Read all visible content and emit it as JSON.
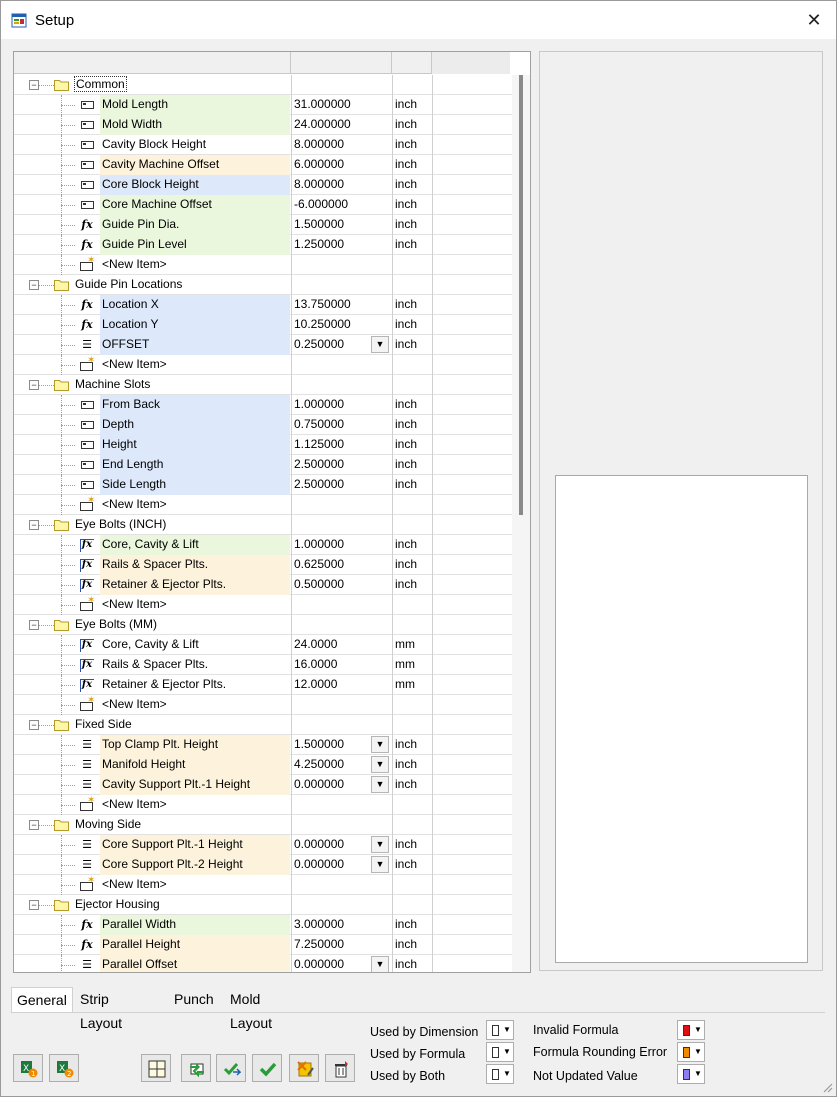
{
  "window": {
    "title": "Setup",
    "close_glyph": "✕"
  },
  "groups": [
    {
      "label": "Common",
      "selected": true,
      "items": [
        {
          "icon": "dimension-icon",
          "name": "Mold Length",
          "value": "31.000000",
          "unit": "inch",
          "bg": "green"
        },
        {
          "icon": "dimension-icon",
          "name": "Mold Width",
          "value": "24.000000",
          "unit": "inch",
          "bg": "green"
        },
        {
          "icon": "dimension-icon",
          "name": "Cavity Block Height",
          "value": "8.000000",
          "unit": "inch",
          "bg": "none"
        },
        {
          "icon": "dimension-icon",
          "name": "Cavity Machine Offset",
          "value": "6.000000",
          "unit": "inch",
          "bg": "yellow"
        },
        {
          "icon": "dimension-icon",
          "name": "Core Block Height",
          "value": "8.000000",
          "unit": "inch",
          "bg": "blue"
        },
        {
          "icon": "dimension-icon",
          "name": "Core Machine Offset",
          "value": "-6.000000",
          "unit": "inch",
          "bg": "green"
        },
        {
          "icon": "formula-icon",
          "name": "Guide Pin Dia.",
          "value": "1.500000",
          "unit": "inch",
          "bg": "green"
        },
        {
          "icon": "formula-icon",
          "name": "Guide Pin Level",
          "value": "1.250000",
          "unit": "inch",
          "bg": "green"
        },
        {
          "icon": "new-item-icon",
          "name": "<New Item>",
          "value": "",
          "unit": "",
          "bg": "none"
        }
      ]
    },
    {
      "label": "Guide Pin Locations",
      "items": [
        {
          "icon": "formula-icon",
          "name": "Location X",
          "value": "13.750000",
          "unit": "inch",
          "bg": "blue"
        },
        {
          "icon": "formula-icon",
          "name": "Location Y",
          "value": "10.250000",
          "unit": "inch",
          "bg": "blue"
        },
        {
          "icon": "list-icon",
          "name": "OFFSET",
          "value": "0.250000",
          "unit": "inch",
          "bg": "blue",
          "dropdown": true
        },
        {
          "icon": "new-item-icon",
          "name": "<New Item>",
          "value": "",
          "unit": "",
          "bg": "none"
        }
      ]
    },
    {
      "label": "Machine Slots",
      "items": [
        {
          "icon": "dimension-icon",
          "name": "From Back",
          "value": "1.000000",
          "unit": "inch",
          "bg": "blue"
        },
        {
          "icon": "dimension-icon",
          "name": "Depth",
          "value": "0.750000",
          "unit": "inch",
          "bg": "blue"
        },
        {
          "icon": "dimension-icon",
          "name": "Height",
          "value": "1.125000",
          "unit": "inch",
          "bg": "blue"
        },
        {
          "icon": "dimension-icon",
          "name": "End Length",
          "value": "2.500000",
          "unit": "inch",
          "bg": "blue"
        },
        {
          "icon": "dimension-icon",
          "name": "Side Length",
          "value": "2.500000",
          "unit": "inch",
          "bg": "blue"
        },
        {
          "icon": "new-item-icon",
          "name": "<New Item>",
          "value": "",
          "unit": "",
          "bg": "none"
        }
      ]
    },
    {
      "label": "Eye Bolts (INCH)",
      "items": [
        {
          "icon": "formula-box-icon",
          "name": "Core, Cavity & Lift",
          "value": "1.000000",
          "unit": "inch",
          "bg": "green"
        },
        {
          "icon": "formula-box-icon",
          "name": "Rails & Spacer Plts.",
          "value": "0.625000",
          "unit": "inch",
          "bg": "yellow"
        },
        {
          "icon": "formula-box-icon",
          "name": "Retainer & Ejector Plts.",
          "value": "0.500000",
          "unit": "inch",
          "bg": "yellow"
        },
        {
          "icon": "new-item-icon",
          "name": "<New Item>",
          "value": "",
          "unit": "",
          "bg": "none"
        }
      ]
    },
    {
      "label": "Eye Bolts (MM)",
      "items": [
        {
          "icon": "formula-box-icon",
          "name": "Core, Cavity & Lift",
          "value": "24.0000",
          "unit": "mm",
          "bg": "none"
        },
        {
          "icon": "formula-box-icon",
          "name": "Rails & Spacer Plts.",
          "value": "16.0000",
          "unit": "mm",
          "bg": "none"
        },
        {
          "icon": "formula-box-icon",
          "name": "Retainer & Ejector Plts.",
          "value": "12.0000",
          "unit": "mm",
          "bg": "none"
        },
        {
          "icon": "new-item-icon",
          "name": "<New Item>",
          "value": "",
          "unit": "",
          "bg": "none"
        }
      ]
    },
    {
      "label": "Fixed Side",
      "items": [
        {
          "icon": "list-icon",
          "name": "Top Clamp Plt. Height",
          "value": "1.500000",
          "unit": "inch",
          "bg": "yellow",
          "dropdown": true
        },
        {
          "icon": "list-icon",
          "name": "Manifold Height",
          "value": "4.250000",
          "unit": "inch",
          "bg": "yellow",
          "dropdown": true
        },
        {
          "icon": "list-icon",
          "name": "Cavity Support Plt.-1  Height",
          "value": "0.000000",
          "unit": "inch",
          "bg": "yellow",
          "dropdown": true
        },
        {
          "icon": "new-item-icon",
          "name": "<New Item>",
          "value": "",
          "unit": "",
          "bg": "none"
        }
      ]
    },
    {
      "label": "Moving Side",
      "items": [
        {
          "icon": "list-icon",
          "name": "Core Support Plt.-1  Height",
          "value": "0.000000",
          "unit": "inch",
          "bg": "yellow",
          "dropdown": true
        },
        {
          "icon": "list-icon",
          "name": "Core Support Plt.-2  Height",
          "value": "0.000000",
          "unit": "inch",
          "bg": "yellow",
          "dropdown": true
        },
        {
          "icon": "new-item-icon",
          "name": "<New Item>",
          "value": "",
          "unit": "",
          "bg": "none"
        }
      ]
    },
    {
      "label": "Ejector Housing",
      "items": [
        {
          "icon": "formula-icon",
          "name": "Parallel Width",
          "value": "3.000000",
          "unit": "inch",
          "bg": "green"
        },
        {
          "icon": "formula-icon",
          "name": "Parallel Height",
          "value": "7.250000",
          "unit": "inch",
          "bg": "yellow"
        },
        {
          "icon": "list-icon",
          "name": "Parallel Offset",
          "value": "0.000000",
          "unit": "inch",
          "bg": "yellow",
          "dropdown": true
        }
      ]
    }
  ],
  "tabs": [
    "General",
    "Strip Layout",
    "Punch",
    "Mold Layout"
  ],
  "active_tab": 0,
  "legend": {
    "used_by_dimension": "Used by Dimension",
    "used_by_formula": "Used by Formula",
    "used_by_both": "Used by Both",
    "invalid_formula": "Invalid Formula",
    "formula_rounding_error": "Formula Rounding Error",
    "not_updated_value": "Not Updated Value"
  },
  "colors": {
    "row_green": "#eaf7dd",
    "row_yellow": "#fdf3dc",
    "row_blue": "#dde9fb",
    "invalid_formula": "#e01010",
    "formula_rounding_error": "#f08a00",
    "not_updated_value": "#8c7ef0",
    "used_swatch": "#ffffff"
  },
  "toolbar_icons": [
    "excel-export-1-icon",
    "excel-export-2-icon",
    "layout-grid-icon",
    "refresh-icon",
    "check-arrow-icon",
    "check-icon",
    "edit-icon",
    "delete-icon"
  ]
}
